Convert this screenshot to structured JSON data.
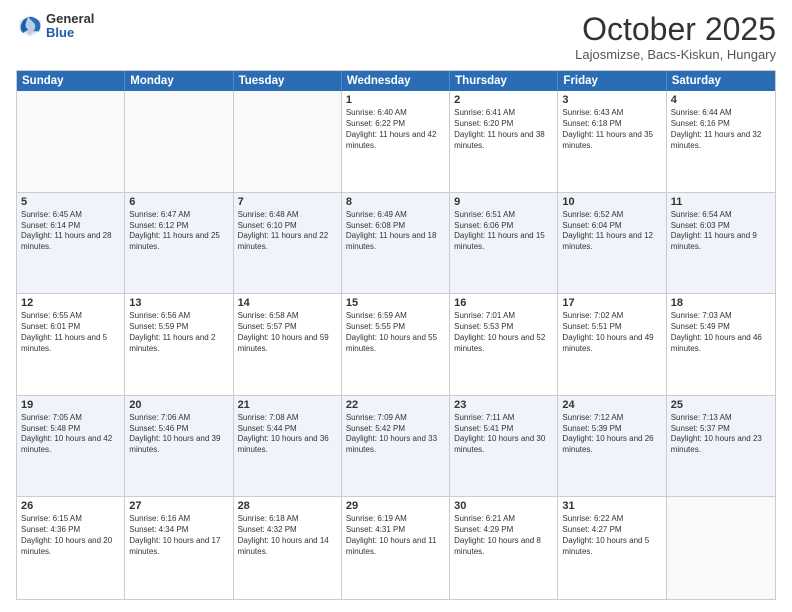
{
  "logo": {
    "general": "General",
    "blue": "Blue"
  },
  "header": {
    "month": "October 2025",
    "location": "Lajosmizse, Bacs-Kiskun, Hungary"
  },
  "days": [
    "Sunday",
    "Monday",
    "Tuesday",
    "Wednesday",
    "Thursday",
    "Friday",
    "Saturday"
  ],
  "weeks": [
    [
      {
        "day": "",
        "info": ""
      },
      {
        "day": "",
        "info": ""
      },
      {
        "day": "",
        "info": ""
      },
      {
        "day": "1",
        "info": "Sunrise: 6:40 AM\nSunset: 6:22 PM\nDaylight: 11 hours and 42 minutes."
      },
      {
        "day": "2",
        "info": "Sunrise: 6:41 AM\nSunset: 6:20 PM\nDaylight: 11 hours and 38 minutes."
      },
      {
        "day": "3",
        "info": "Sunrise: 6:43 AM\nSunset: 6:18 PM\nDaylight: 11 hours and 35 minutes."
      },
      {
        "day": "4",
        "info": "Sunrise: 6:44 AM\nSunset: 6:16 PM\nDaylight: 11 hours and 32 minutes."
      }
    ],
    [
      {
        "day": "5",
        "info": "Sunrise: 6:45 AM\nSunset: 6:14 PM\nDaylight: 11 hours and 28 minutes."
      },
      {
        "day": "6",
        "info": "Sunrise: 6:47 AM\nSunset: 6:12 PM\nDaylight: 11 hours and 25 minutes."
      },
      {
        "day": "7",
        "info": "Sunrise: 6:48 AM\nSunset: 6:10 PM\nDaylight: 11 hours and 22 minutes."
      },
      {
        "day": "8",
        "info": "Sunrise: 6:49 AM\nSunset: 6:08 PM\nDaylight: 11 hours and 18 minutes."
      },
      {
        "day": "9",
        "info": "Sunrise: 6:51 AM\nSunset: 6:06 PM\nDaylight: 11 hours and 15 minutes."
      },
      {
        "day": "10",
        "info": "Sunrise: 6:52 AM\nSunset: 6:04 PM\nDaylight: 11 hours and 12 minutes."
      },
      {
        "day": "11",
        "info": "Sunrise: 6:54 AM\nSunset: 6:03 PM\nDaylight: 11 hours and 9 minutes."
      }
    ],
    [
      {
        "day": "12",
        "info": "Sunrise: 6:55 AM\nSunset: 6:01 PM\nDaylight: 11 hours and 5 minutes."
      },
      {
        "day": "13",
        "info": "Sunrise: 6:56 AM\nSunset: 5:59 PM\nDaylight: 11 hours and 2 minutes."
      },
      {
        "day": "14",
        "info": "Sunrise: 6:58 AM\nSunset: 5:57 PM\nDaylight: 10 hours and 59 minutes."
      },
      {
        "day": "15",
        "info": "Sunrise: 6:59 AM\nSunset: 5:55 PM\nDaylight: 10 hours and 55 minutes."
      },
      {
        "day": "16",
        "info": "Sunrise: 7:01 AM\nSunset: 5:53 PM\nDaylight: 10 hours and 52 minutes."
      },
      {
        "day": "17",
        "info": "Sunrise: 7:02 AM\nSunset: 5:51 PM\nDaylight: 10 hours and 49 minutes."
      },
      {
        "day": "18",
        "info": "Sunrise: 7:03 AM\nSunset: 5:49 PM\nDaylight: 10 hours and 46 minutes."
      }
    ],
    [
      {
        "day": "19",
        "info": "Sunrise: 7:05 AM\nSunset: 5:48 PM\nDaylight: 10 hours and 42 minutes."
      },
      {
        "day": "20",
        "info": "Sunrise: 7:06 AM\nSunset: 5:46 PM\nDaylight: 10 hours and 39 minutes."
      },
      {
        "day": "21",
        "info": "Sunrise: 7:08 AM\nSunset: 5:44 PM\nDaylight: 10 hours and 36 minutes."
      },
      {
        "day": "22",
        "info": "Sunrise: 7:09 AM\nSunset: 5:42 PM\nDaylight: 10 hours and 33 minutes."
      },
      {
        "day": "23",
        "info": "Sunrise: 7:11 AM\nSunset: 5:41 PM\nDaylight: 10 hours and 30 minutes."
      },
      {
        "day": "24",
        "info": "Sunrise: 7:12 AM\nSunset: 5:39 PM\nDaylight: 10 hours and 26 minutes."
      },
      {
        "day": "25",
        "info": "Sunrise: 7:13 AM\nSunset: 5:37 PM\nDaylight: 10 hours and 23 minutes."
      }
    ],
    [
      {
        "day": "26",
        "info": "Sunrise: 6:15 AM\nSunset: 4:36 PM\nDaylight: 10 hours and 20 minutes."
      },
      {
        "day": "27",
        "info": "Sunrise: 6:16 AM\nSunset: 4:34 PM\nDaylight: 10 hours and 17 minutes."
      },
      {
        "day": "28",
        "info": "Sunrise: 6:18 AM\nSunset: 4:32 PM\nDaylight: 10 hours and 14 minutes."
      },
      {
        "day": "29",
        "info": "Sunrise: 6:19 AM\nSunset: 4:31 PM\nDaylight: 10 hours and 11 minutes."
      },
      {
        "day": "30",
        "info": "Sunrise: 6:21 AM\nSunset: 4:29 PM\nDaylight: 10 hours and 8 minutes."
      },
      {
        "day": "31",
        "info": "Sunrise: 6:22 AM\nSunset: 4:27 PM\nDaylight: 10 hours and 5 minutes."
      },
      {
        "day": "",
        "info": ""
      }
    ]
  ]
}
